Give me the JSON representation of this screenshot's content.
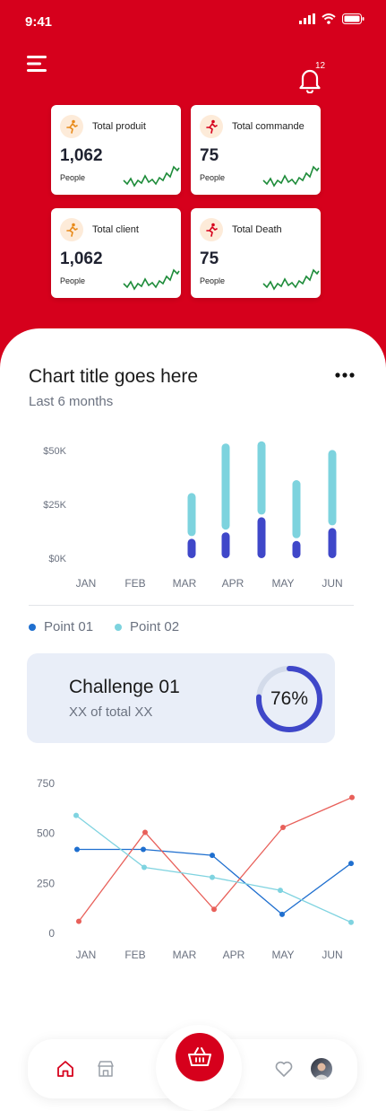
{
  "status_bar": {
    "time": "9:41",
    "icons": [
      "signal-icon",
      "wifi-icon",
      "battery-icon"
    ]
  },
  "header": {
    "menu_icon": "hamburger-menu-icon",
    "notification_icon": "bell-icon",
    "notification_count": "12"
  },
  "stats": [
    {
      "label": "Total produit",
      "value": "1,062",
      "unit": "People",
      "icon": "running-person-icon",
      "icon_color": "#e88a1a"
    },
    {
      "label": "Total commande",
      "value": "75",
      "unit": "People",
      "icon": "running-person-icon",
      "icon_color": "#d6001c"
    },
    {
      "label": "Total client",
      "value": "1,062",
      "unit": "People",
      "icon": "running-person-icon",
      "icon_color": "#e88a1a"
    },
    {
      "label": "Total Death",
      "value": "75",
      "unit": "People",
      "icon": "running-person-icon",
      "icon_color": "#d6001c"
    }
  ],
  "bar_section": {
    "title": "Chart title goes here",
    "subtitle": "Last 6 months",
    "more_icon": "more-dots-icon"
  },
  "chart_data": [
    {
      "type": "bar",
      "categories": [
        "JAN",
        "FEB",
        "MAR",
        "APR",
        "MAY",
        "JUN"
      ],
      "y_ticks": [
        "$0K",
        "$25K",
        "$50K"
      ],
      "ylim": [
        0,
        50000
      ],
      "stacked": true,
      "series": [
        {
          "name": "Point 01",
          "color": "#3f47c9",
          "values": [
            0,
            9000,
            12000,
            19000,
            8000,
            14000
          ]
        },
        {
          "name": "Point 02",
          "color": "#7dd3de",
          "values": [
            0,
            20000,
            40000,
            34000,
            27000,
            35000
          ]
        }
      ],
      "grid": false
    },
    {
      "type": "line",
      "categories": [
        "JAN",
        "FEB",
        "MAR",
        "APR",
        "MAY",
        "JUN"
      ],
      "y_ticks": [
        "0",
        "250",
        "500",
        "750"
      ],
      "ylim": [
        0,
        750
      ],
      "series": [
        {
          "color": "#1f6fcf",
          "values": [
            420,
            420,
            390,
            95,
            350
          ]
        },
        {
          "color": "#e8605a",
          "values": [
            60,
            505,
            120,
            530,
            680
          ]
        },
        {
          "color": "#7fd3e0",
          "values": [
            590,
            330,
            280,
            215,
            55
          ]
        }
      ],
      "grid": false
    }
  ],
  "legend": [
    {
      "label": "Point 01",
      "color": "#1f6fcf"
    },
    {
      "label": "Point 02",
      "color": "#7dd3de"
    }
  ],
  "challenge": {
    "title": "Challenge 01",
    "subtitle": "XX of total XX",
    "percent_label": "76%",
    "progress": 0.76,
    "ring_color": "#3f47c9"
  },
  "bottom_nav": {
    "items": [
      "home-icon",
      "store-icon",
      "basket-icon",
      "heart-icon",
      "avatar"
    ],
    "accent": "#d6001c"
  }
}
